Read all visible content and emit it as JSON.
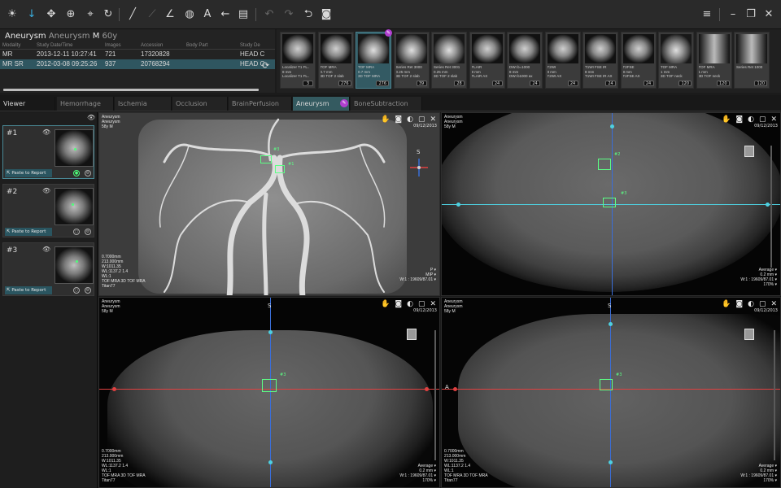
{
  "toolbar": {
    "icons": [
      "brightness-icon",
      "probe-icon",
      "pan-icon",
      "zoom-icon",
      "crosshair-icon",
      "rotate-icon",
      "line-icon",
      "polyline-icon",
      "angle-icon",
      "circle-icon",
      "text-icon",
      "arrow-icon",
      "report-icon",
      "undo-icon",
      "redo-icon",
      "reset-icon",
      "screenshot-icon",
      "menu-icon",
      "minimize-icon",
      "restore-icon",
      "close-icon"
    ]
  },
  "patient": {
    "name": "Aneurysm",
    "name2": "Aneurysm",
    "sex": "M",
    "age": "60y"
  },
  "study_table": {
    "headers": [
      "Modality",
      "Study Date/Time",
      "Images",
      "Accession",
      "Body Part",
      "Study De"
    ],
    "rows": [
      [
        "MR",
        "2013-12-11 10:27:41",
        "721",
        "17320828",
        "",
        "HEAD C"
      ],
      [
        "MR SR",
        "2012-03-08 09:25:26",
        "937",
        "20768294",
        "",
        "HEAD C"
      ]
    ]
  },
  "series": [
    {
      "l1": "Localizer T1 FL..",
      "l2": "8 mm",
      "l3": "Localizer T1 FL..",
      "count": "3",
      "img": "brain"
    },
    {
      "l1": "TOF MRA",
      "l2": "0.7 mm",
      "l3": "3D TOF 2 slab",
      "count": "276",
      "img": "brain"
    },
    {
      "l1": "TOF MRA",
      "l2": "0.7 mm",
      "l3": "3D TOF MRA",
      "count": "276",
      "img": "mip"
    },
    {
      "l1": "Series Ret 3000",
      "l2": "0.25 mm",
      "l3": "3D TOF 2 slab",
      "count": "39",
      "img": "mip"
    },
    {
      "l1": "Series Ret 3001",
      "l2": "0.25 mm",
      "l3": "3D TOF 2 slab",
      "count": "28",
      "img": "mip"
    },
    {
      "l1": "FLAIR",
      "l2": "8 mm",
      "l3": "FLAIR AX",
      "count": "24",
      "img": "brain"
    },
    {
      "l1": "DWI b=1000",
      "l2": "8 mm",
      "l3": "DWI b1000 ax",
      "count": "24",
      "img": "brain"
    },
    {
      "l1": "T2WI",
      "l2": "8 mm",
      "l3": "T2WI AX",
      "count": "24",
      "img": "brain"
    },
    {
      "l1": "T1WI FSE IR",
      "l2": "8 mm",
      "l3": "T1WI FSE IR AX",
      "count": "24",
      "img": "brain"
    },
    {
      "l1": "T2FSE",
      "l2": "8 mm",
      "l3": "T2FSE AX",
      "count": "24",
      "img": "brain"
    },
    {
      "l1": "TOF MRA",
      "l2": "1 mm",
      "l3": "3D TOF neck",
      "count": "120",
      "img": "mip"
    },
    {
      "l1": "TOF MRA",
      "l2": "1 mm",
      "l3": "3D TOF neck",
      "count": "120",
      "img": "neck"
    },
    {
      "l1": "Series Ret 1000",
      "l2": "",
      "l3": "",
      "count": "120",
      "img": "neck"
    }
  ],
  "tabs": [
    "Viewer",
    "Hemorrhage",
    "Ischemia",
    "Occlusion",
    "BrainPerfusion",
    "Aneurysm",
    "BoneSubtraction"
  ],
  "findings": [
    {
      "num": "#1",
      "paste": "Paste to Report"
    },
    {
      "num": "#2",
      "paste": "Paste to Report"
    },
    {
      "num": "#3",
      "paste": "Paste to Report"
    }
  ],
  "viewports": {
    "vr": {
      "top": [
        "Aneurysm",
        "Aneurysm",
        "58y M"
      ],
      "date": "09/12/2013",
      "bottom": [
        "0.7000mm",
        "213.000mm",
        "W:1011.35",
        "WL:1137.2 1.4",
        "WL:1",
        "TOF MRA 3D TOF MRA",
        "Titan77"
      ],
      "right": [
        "P ▾",
        "MIP ▾",
        "W:1 : 19609/87.01 ▾"
      ],
      "orient_s": "S"
    },
    "axial": {
      "top": [
        "Aneurysm",
        "Aneurysm",
        "58y M"
      ],
      "date": "09/12/2013",
      "right": [
        "Average ▾",
        "0.2 mm ▾",
        "W:1 : 19609/87.01 ▾",
        "170% ▾"
      ]
    },
    "coronal": {
      "top": [
        "Aneurysm",
        "Aneurysm",
        "58y M"
      ],
      "date": "09/12/2013",
      "bottom": [
        "0.7000mm",
        "213.000mm",
        "W:1011.35",
        "WL:1137.2 1.4",
        "WL:1",
        "TOF MRA 3D TOF MRA",
        "Titan77"
      ],
      "right": [
        "Average ▾",
        "0.2 mm ▾",
        "W:1 : 19609/87.01 ▾",
        "170% ▾"
      ],
      "orient_s": "S"
    },
    "sagittal": {
      "top": [
        "Aneurysm",
        "Aneurysm",
        "58y M"
      ],
      "date": "09/12/2013",
      "bottom": [
        "0.7000mm",
        "213.000mm",
        "W:1011.35",
        "WL:1137.2 1.4",
        "WL:1",
        "TOF MRA 3D TOF MRA",
        "Titan77"
      ],
      "right": [
        "Average ▾",
        "0.2 mm ▾",
        "W:1 : 19609/87.01 ▾",
        "170% ▾"
      ],
      "orient_s": "S",
      "orient_a": "A"
    }
  },
  "colors": {
    "accent": "#2f5660",
    "purple": "#b13fd0",
    "green": "#5cff85",
    "red": "#e04040",
    "blue": "#3a6ed8",
    "cyan": "#4ed0e0"
  }
}
